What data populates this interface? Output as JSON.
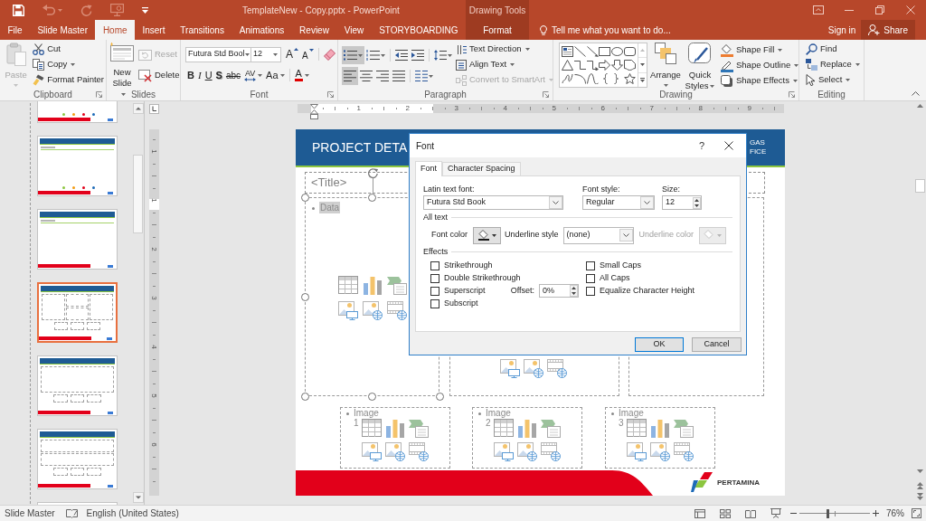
{
  "title_bar": {
    "quick_access": [
      {
        "kind": "save",
        "disabled": false,
        "dropdown": false
      },
      {
        "kind": "undo",
        "disabled": true,
        "dropdown": true
      },
      {
        "kind": "redo",
        "disabled": true,
        "dropdown": false
      },
      {
        "kind": "present",
        "disabled": true,
        "dropdown": false
      },
      {
        "kind": "customize",
        "disabled": false,
        "dropdown": false
      }
    ],
    "title": "TemplateNew - Copy.pptx - PowerPoint",
    "context_label": "Drawing Tools"
  },
  "tabs": [
    {
      "label": "File",
      "kind": "normal",
      "selected": false
    },
    {
      "label": "Slide Master",
      "kind": "normal",
      "selected": false
    },
    {
      "label": "Home",
      "kind": "normal",
      "selected": true
    },
    {
      "label": "Insert",
      "kind": "normal",
      "selected": false
    },
    {
      "label": "Transitions",
      "kind": "normal",
      "selected": false
    },
    {
      "label": "Animations",
      "kind": "normal",
      "selected": false
    },
    {
      "label": "Review",
      "kind": "normal",
      "selected": false
    },
    {
      "label": "View",
      "kind": "normal",
      "selected": false
    },
    {
      "label": "STORYBOARDING",
      "kind": "normal",
      "selected": false
    },
    {
      "label": "Format",
      "kind": "contextual",
      "selected": false
    }
  ],
  "tell_me": "Tell me what you want to do...",
  "account": {
    "sign_in": "Sign in",
    "share": "Share"
  },
  "ribbon": {
    "clipboard": {
      "label": "Clipboard",
      "paste": {
        "label": "Paste",
        "disabled": true
      },
      "commands": [
        {
          "kind": "cut",
          "label": "Cut",
          "dropdown": false
        },
        {
          "kind": "copy",
          "label": "Copy",
          "dropdown": true
        },
        {
          "kind": "format_painter",
          "label": "Format Painter",
          "dropdown": false
        }
      ]
    },
    "slides": {
      "label": "Slides",
      "new_slide": "New Slide",
      "commands": [
        {
          "kind": "reset",
          "label": "Reset",
          "disabled": true
        },
        {
          "kind": "delete",
          "label": "Delete",
          "disabled": false
        }
      ]
    },
    "font": {
      "label": "Font",
      "font_name": "Futura Std Bool",
      "font_size": "12",
      "row1": [
        [
          {
            "kind": "grow",
            "glyph": "A"
          },
          {
            "kind": "shrink",
            "glyph": "A"
          }
        ],
        [
          {
            "kind": "clear"
          }
        ]
      ],
      "row2": [
        [
          {
            "kind": "bold",
            "glyph": "B",
            "dropdown": false
          },
          {
            "kind": "italic",
            "glyph": "I",
            "dropdown": false
          },
          {
            "kind": "underline",
            "glyph": "U",
            "dropdown": false
          },
          {
            "kind": "shadow",
            "glyph": "S",
            "dropdown": false
          },
          {
            "kind": "strike",
            "glyph": "abc",
            "dropdown": false
          },
          {
            "kind": "spacing",
            "glyph": "AV",
            "dropdown": true
          },
          {
            "kind": "case",
            "glyph": "Aa",
            "dropdown": true
          }
        ],
        [
          {
            "kind": "color",
            "glyph": "A",
            "dropdown": true
          }
        ]
      ]
    },
    "paragraph": {
      "label": "Paragraph",
      "row1": [
        [
          {
            "kind": "bullets",
            "selected": true,
            "dropdown": true
          },
          {
            "kind": "numbering",
            "selected": false,
            "dropdown": true
          }
        ],
        [
          {
            "kind": "decrease_indent",
            "selected": false,
            "dropdown": false
          },
          {
            "kind": "increase_indent",
            "selected": false,
            "dropdown": false
          }
        ],
        [
          {
            "kind": "line_spacing",
            "selected": false,
            "dropdown": true
          }
        ]
      ],
      "row2": [
        [
          {
            "kind": "align_left",
            "selected": true,
            "dropdown": false
          },
          {
            "kind": "center",
            "selected": false,
            "dropdown": false
          },
          {
            "kind": "align_right",
            "selected": false,
            "dropdown": false
          },
          {
            "kind": "justify",
            "selected": false,
            "dropdown": false
          }
        ],
        [
          {
            "kind": "columns",
            "selected": false,
            "dropdown": true
          }
        ]
      ],
      "commands": [
        {
          "kind": "text_direction",
          "label": "Text Direction",
          "disabled": false
        },
        {
          "kind": "align_text",
          "label": "Align Text",
          "disabled": false
        },
        {
          "kind": "smartart",
          "label": "Convert to SmartArt",
          "disabled": true
        }
      ]
    },
    "drawing": {
      "label": "Drawing",
      "shapes": [
        {
          "kind": "textbox"
        },
        {
          "kind": "line"
        },
        {
          "kind": "arrow"
        },
        {
          "kind": "rectangle"
        },
        {
          "kind": "oval"
        },
        {
          "kind": "rounded_rectangle"
        },
        {
          "kind": "triangle"
        },
        {
          "kind": "elbow"
        },
        {
          "kind": "elbow_arrow"
        },
        {
          "kind": "right_arrow"
        },
        {
          "kind": "down_arrow"
        },
        {
          "kind": "snip"
        },
        {
          "kind": "freeform"
        },
        {
          "kind": "arc"
        },
        {
          "kind": "wave"
        },
        {
          "kind": "left_brace"
        },
        {
          "kind": "right_brace"
        },
        {
          "kind": "star"
        }
      ],
      "arrange": "Arrange",
      "quick_styles": "Quick Styles",
      "commands": [
        {
          "kind": "fill",
          "label": "Shape Fill"
        },
        {
          "kind": "outline",
          "label": "Shape Outline"
        },
        {
          "kind": "effects",
          "label": "Shape Effects"
        }
      ]
    },
    "editing": {
      "label": "Editing",
      "commands": [
        {
          "kind": "find",
          "label": "Find",
          "dropdown": false
        },
        {
          "kind": "replace",
          "label": "Replace",
          "dropdown": true
        },
        {
          "kind": "select",
          "label": "Select",
          "dropdown": true
        }
      ]
    }
  },
  "thumbnails": [
    {
      "kind": "legend",
      "selected": false
    },
    {
      "kind": "legend",
      "selected": false
    },
    {
      "kind": "blank",
      "selected": false
    },
    {
      "kind": "grid",
      "selected": true
    },
    {
      "kind": "wide",
      "selected": false
    },
    {
      "kind": "split",
      "selected": false
    },
    {
      "kind": "blank",
      "selected": false
    }
  ],
  "rulers": {
    "horizontal": [
      "1",
      "2",
      "3",
      "4",
      "5",
      "6",
      "7",
      "8",
      "9"
    ],
    "vertical": [
      "1",
      "1",
      "2",
      "3",
      "4",
      "5",
      "6"
    ]
  },
  "slide": {
    "heading": "PROJECT DETA",
    "side_lines": [
      "GAS",
      "FICE"
    ],
    "title_placeholder": "<Title>",
    "body_placeholder": {
      "text": "Data",
      "text_selected": true
    },
    "image_boxes": [
      "Image 1",
      "Image 2",
      "Image 3"
    ],
    "logo_text": "PERTAMINA"
  },
  "font_dialog": {
    "title": "Font",
    "help": "?",
    "tabs": [
      {
        "label": "Font",
        "selected": true
      },
      {
        "label": "Character Spacing",
        "selected": false
      }
    ],
    "latin_font": {
      "label": "Latin text font:",
      "value": "Futura Std Book"
    },
    "font_style": {
      "label": "Font style:",
      "value": "Regular"
    },
    "size": {
      "label": "Size:",
      "value": "12"
    },
    "all_text": "All text",
    "font_color": "Font color",
    "underline_style": {
      "label": "Underline style",
      "value": "(none)"
    },
    "underline_color": {
      "label": "Underline color",
      "disabled": true
    },
    "effects": "Effects",
    "effects_left": [
      {
        "label": "Strikethrough",
        "checked": false
      },
      {
        "label": "Double Strikethrough",
        "checked": false
      },
      {
        "label": "Superscript",
        "checked": false
      },
      {
        "label": "Subscript",
        "checked": false
      }
    ],
    "effects_right": [
      {
        "label": "Small Caps",
        "checked": false
      },
      {
        "label": "All Caps",
        "checked": false
      },
      {
        "label": "Equalize Character Height",
        "checked": false
      }
    ],
    "offset": {
      "label": "Offset:",
      "value": "0%"
    },
    "buttons": [
      {
        "label": "OK",
        "default": true
      },
      {
        "label": "Cancel",
        "default": false
      }
    ]
  },
  "status_bar": {
    "mode": "Slide Master",
    "language": "English (United States)",
    "zoom_slider": {
      "level": 0.4
    },
    "zoom": "76%"
  }
}
